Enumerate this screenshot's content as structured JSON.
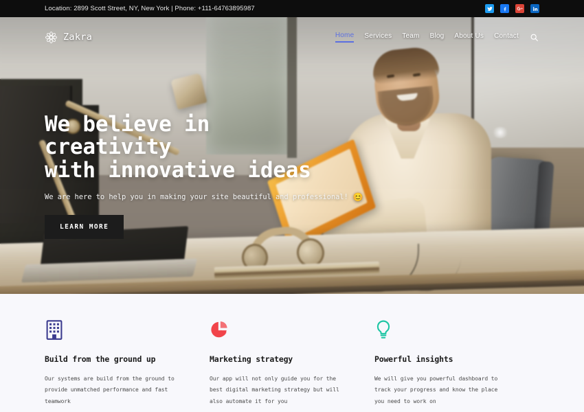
{
  "topbar": {
    "info": "Location: 2899 Scott Street, NY, New York | Phone: +111-64763895987",
    "social": [
      {
        "name": "twitter",
        "glyph": "t",
        "color": "#1d9bf0"
      },
      {
        "name": "facebook",
        "glyph": "f",
        "color": "#1877f2"
      },
      {
        "name": "google-plus",
        "glyph": "g",
        "color": "#db4437"
      },
      {
        "name": "linkedin",
        "glyph": "in",
        "color": "#0a66c2"
      }
    ]
  },
  "header": {
    "brand": "Zakra",
    "brand_icon": "flower-logo-icon",
    "search_icon": "search-icon",
    "nav": [
      {
        "label": "Home",
        "active": true
      },
      {
        "label": "Services",
        "active": false
      },
      {
        "label": "Team",
        "active": false
      },
      {
        "label": "Blog",
        "active": false
      },
      {
        "label": "About Us",
        "active": false
      },
      {
        "label": "Contact",
        "active": false
      }
    ],
    "active_color": "#5b6fe0"
  },
  "hero": {
    "title_line1": "We believe in creativity",
    "title_line2": "with innovative ideas",
    "subtitle": "We are here to help you in making your site beautiful and professional!",
    "subtitle_emoji": "😊",
    "button_label": "LEARN MORE",
    "button_color": "#1c1c1c",
    "scene_description": "Smiling bearded man in a light shirt holding an orange folder at an office desk with a lamp, monitor, laptop and headphones"
  },
  "features": {
    "background": "#f8f8fc",
    "items": [
      {
        "icon": "building-icon",
        "icon_color": "#3b3b8f",
        "title": "Build from the ground up",
        "text": "Our systems are build from the ground to provide unmatched performance and fast teamwork"
      },
      {
        "icon": "pie-chart-icon",
        "icon_color": "#f1444a",
        "title": "Marketing strategy",
        "text": "Our app will not only guide you for the best digital marketing strategy but will also automate it for you"
      },
      {
        "icon": "lightbulb-icon",
        "icon_color": "#1dc5a3",
        "title": "Powerful insights",
        "text": "We will give you powerful dashboard to track your progress and know the place you need to work on"
      }
    ]
  }
}
